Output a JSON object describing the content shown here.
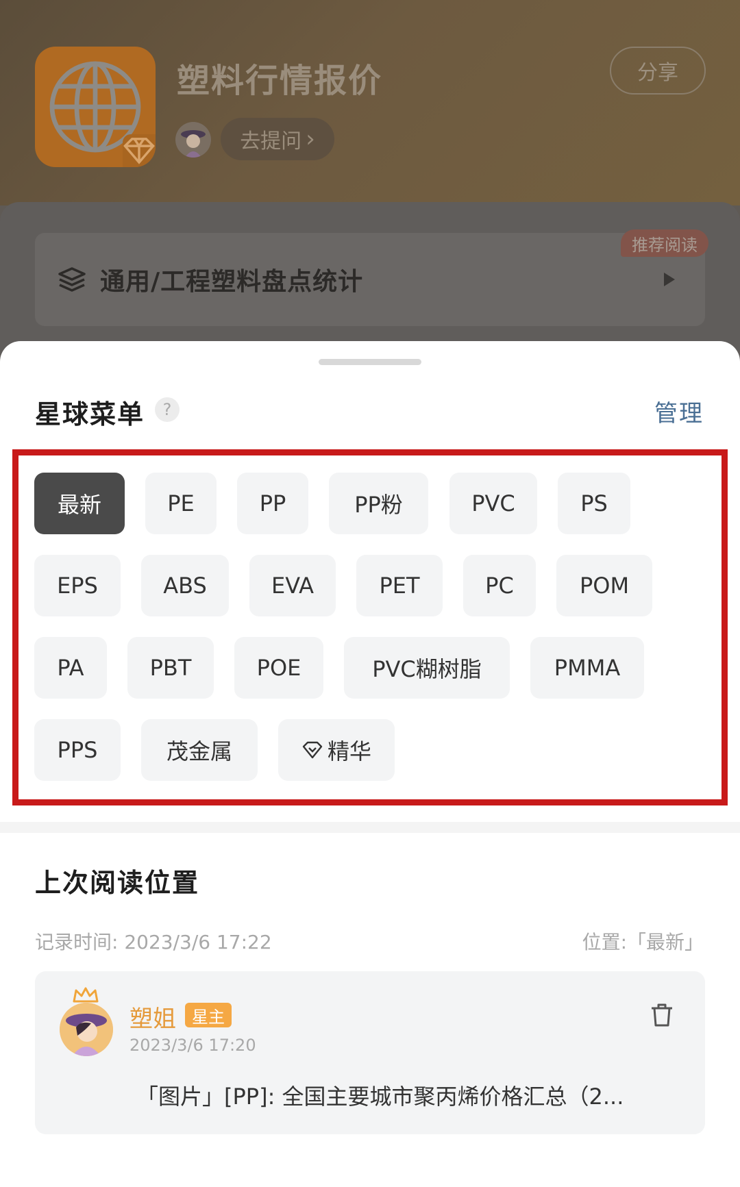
{
  "header": {
    "app_title": "塑料行情报价",
    "share_label": "分享",
    "ask_label": "去提问",
    "ask_chevron": "›"
  },
  "featured": {
    "badge": "推荐阅读",
    "label": "通用/工程塑料盘点统计"
  },
  "menu": {
    "title": "星球菜单",
    "help": "?",
    "manage": "管理",
    "tags": [
      "最新",
      "PE",
      "PP",
      "PP粉",
      "PVC",
      "PS",
      "EPS",
      "ABS",
      "EVA",
      "PET",
      "PC",
      "POM",
      "PA",
      "PBT",
      "POE",
      "PVC糊树脂",
      "PMMA",
      "PPS",
      "茂金属",
      "精华"
    ],
    "active_tag": "最新"
  },
  "last_read": {
    "title": "上次阅读位置",
    "record_time": "记录时间: 2023/3/6 17:22",
    "position": "位置:「最新」",
    "post": {
      "author": "塑姐",
      "author_badge": "星主",
      "time": "2023/3/6 17:20",
      "text": "「图片」[PP]: 全国主要城市聚丙烯价格汇总（2..."
    }
  },
  "colors": {
    "accent": "#e59a3b",
    "manage_link": "#4a6f94",
    "highlight_frame": "#c81a1a",
    "active_tag_bg": "#4a4a4a"
  },
  "icons": [
    "globe-icon",
    "diamond-icon",
    "stack-icon",
    "play-icon",
    "help-icon",
    "crown-icon",
    "trash-icon"
  ]
}
